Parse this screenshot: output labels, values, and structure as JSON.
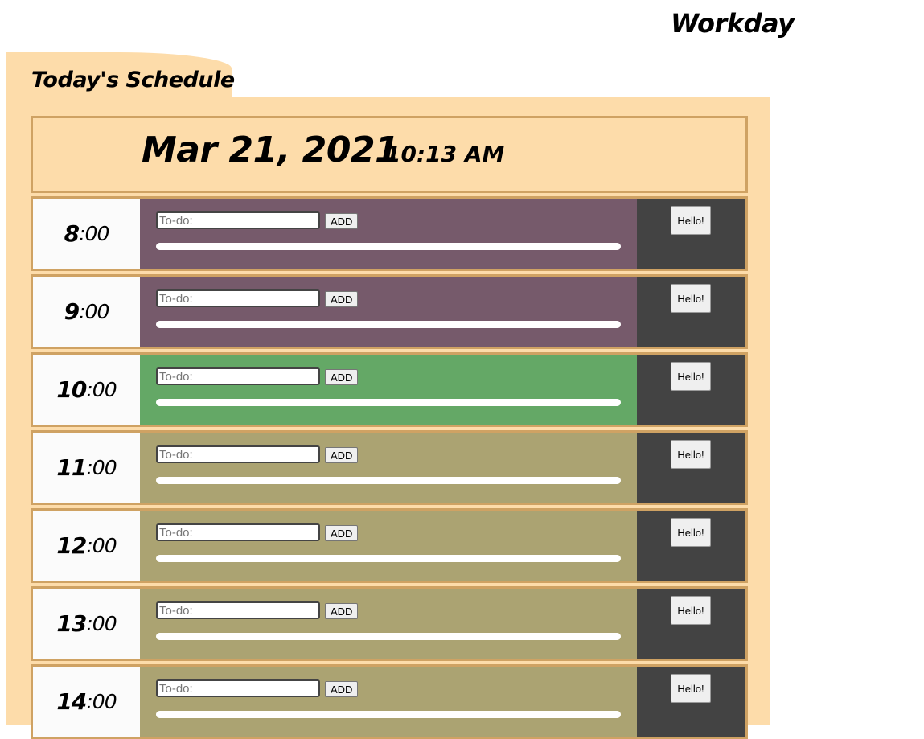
{
  "header": {
    "title": "Workday"
  },
  "tab": {
    "label": "Today's Schedule"
  },
  "datebar": {
    "date": "Mar 21, 2021",
    "time": "10:13 AM"
  },
  "rows": [
    {
      "hour": "8",
      "minutes": ":00",
      "state": "past",
      "placeholder": "To-do:",
      "add_label": "ADD",
      "side_label": "Hello!"
    },
    {
      "hour": "9",
      "minutes": ":00",
      "state": "past",
      "placeholder": "To-do:",
      "add_label": "ADD",
      "side_label": "Hello!"
    },
    {
      "hour": "10",
      "minutes": ":00",
      "state": "present",
      "placeholder": "To-do:",
      "add_label": "ADD",
      "side_label": "Hello!"
    },
    {
      "hour": "11",
      "minutes": ":00",
      "state": "future",
      "placeholder": "To-do:",
      "add_label": "ADD",
      "side_label": "Hello!"
    },
    {
      "hour": "12",
      "minutes": ":00",
      "state": "future",
      "placeholder": "To-do:",
      "add_label": "ADD",
      "side_label": "Hello!"
    },
    {
      "hour": "13",
      "minutes": ":00",
      "state": "future",
      "placeholder": "To-do:",
      "add_label": "ADD",
      "side_label": "Hello!"
    },
    {
      "hour": "14",
      "minutes": ":00",
      "state": "future",
      "placeholder": "To-do:",
      "add_label": "ADD",
      "side_label": "Hello!"
    }
  ],
  "colors": {
    "past": "#765a6b",
    "present": "#64a866",
    "future": "#aba372",
    "panel": "#fddcaa",
    "border": "#cfa263",
    "side": "#434343"
  }
}
